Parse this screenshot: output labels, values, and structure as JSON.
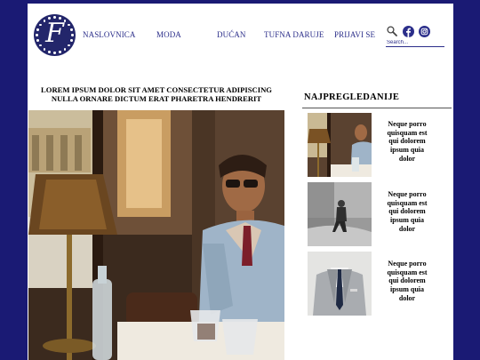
{
  "logo": {
    "letter": "F"
  },
  "nav": {
    "items": [
      "NASLOVNICA",
      "MODA",
      "DUĆAN",
      "TUFNA DARUJE",
      "PRIJAVI SE"
    ]
  },
  "search": {
    "placeholder": "Search..."
  },
  "icons": {
    "search": "search-icon",
    "facebook": "facebook-icon",
    "instagram": "instagram-icon"
  },
  "colors": {
    "page_border": "#1a1a74",
    "brand": "#23266b",
    "nav_text": "#2b2e8a"
  },
  "article": {
    "title_line1": "LOREM IPSUM DOLOR SIT AMET CONSECTETUR ADIPISCING",
    "title_line2": "NULLA ORNARE DICTUM ERAT PHARETRA HENDRERIT"
  },
  "sidebar": {
    "heading": "NAJPREGLEDANIJE",
    "cards": [
      {
        "lines": [
          "Neque porro",
          "quisquam est",
          "qui dolorem",
          "ipsum quia",
          "dolor"
        ]
      },
      {
        "lines": [
          "Neque porro",
          "quisquam est",
          "qui dolorem",
          "ipsum quia",
          "dolor"
        ]
      },
      {
        "lines": [
          "Neque porro",
          "quisquam est",
          "qui dolorem",
          "ipsum quia",
          "dolor"
        ]
      }
    ]
  }
}
